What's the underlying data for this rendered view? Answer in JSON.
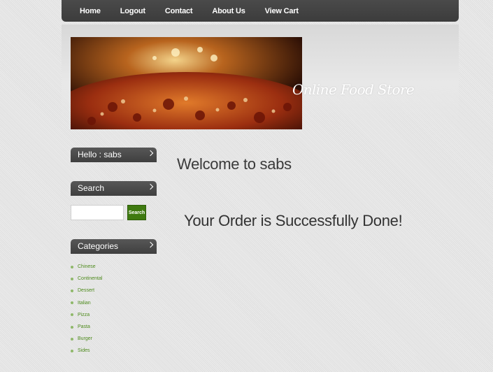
{
  "nav": {
    "items": [
      {
        "label": "Home"
      },
      {
        "label": "Logout"
      },
      {
        "label": "Contact"
      },
      {
        "label": "About Us"
      },
      {
        "label": "View Cart"
      }
    ]
  },
  "header": {
    "store_title": "Online Food Store"
  },
  "sidebar": {
    "hello_heading": "Hello : sabs",
    "search_heading": "Search",
    "search_placeholder": "",
    "search_button": "Search",
    "categories_heading": "Categories",
    "categories": [
      "Chinese",
      "Continental",
      "Dessert",
      "Italian",
      "Pizza",
      "Pasta",
      "Burger",
      "Sides"
    ]
  },
  "main": {
    "welcome": "Welcome to sabs",
    "order_message": "Your Order is Successfully Done!"
  },
  "colors": {
    "nav_bg": "#3c3c3c",
    "accent_green": "#3f7a10",
    "category_link": "#4d8a1c"
  }
}
